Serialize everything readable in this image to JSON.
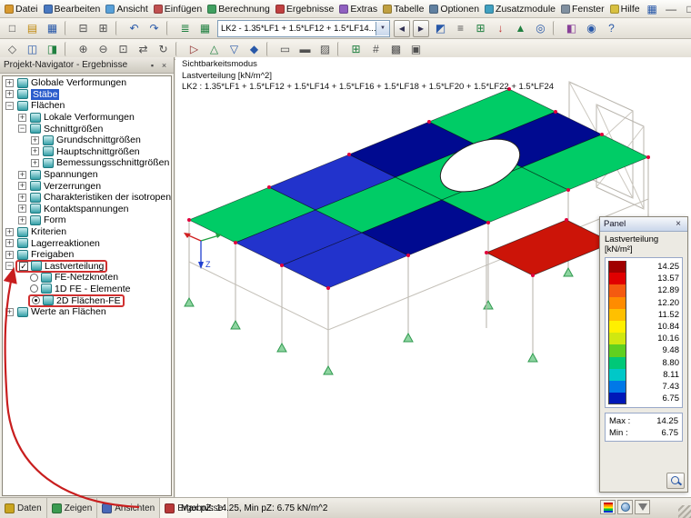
{
  "menu": {
    "items": [
      {
        "label": "Datei",
        "ic": "#d89a30"
      },
      {
        "label": "Bearbeiten",
        "ic": "#4878c0"
      },
      {
        "label": "Ansicht",
        "ic": "#58a0d8"
      },
      {
        "label": "Einfügen",
        "ic": "#c05050"
      },
      {
        "label": "Berechnung",
        "ic": "#40a060"
      },
      {
        "label": "Ergebnisse",
        "ic": "#c04040"
      },
      {
        "label": "Extras",
        "ic": "#9060c0"
      },
      {
        "label": "Tabelle",
        "ic": "#c0a040"
      },
      {
        "label": "Optionen",
        "ic": "#6080a0"
      },
      {
        "label": "Zusatzmodule",
        "ic": "#40a0c0"
      },
      {
        "label": "Fenster",
        "ic": "#8090a0"
      },
      {
        "label": "Hilfe",
        "ic": "#d8c040"
      }
    ],
    "right_icons": [
      {
        "name": "table-view-icon",
        "g": "▦",
        "c": "#2858a8"
      },
      {
        "name": "mdi-minimize-icon",
        "g": "—",
        "c": "#404040"
      },
      {
        "name": "mdi-restore-icon",
        "g": "□",
        "c": "#404040"
      },
      {
        "name": "mdi-close-icon",
        "g": "×",
        "c": "#404040"
      }
    ]
  },
  "toolbar1": {
    "icons_a": [
      {
        "name": "new-project-icon",
        "g": "□",
        "c": "#505050"
      },
      {
        "name": "open-project-icon",
        "g": "▤",
        "c": "#c08a10"
      },
      {
        "name": "save-icon",
        "g": "▦",
        "c": "#2858a8"
      },
      {
        "name": "separator",
        "g": "",
        "cls": "sep"
      },
      {
        "name": "print-icon",
        "g": "⊟",
        "c": "#505050"
      },
      {
        "name": "copy-icon",
        "g": "⊞",
        "c": "#505050"
      },
      {
        "name": "separator",
        "g": "",
        "cls": "sep"
      },
      {
        "name": "undo-icon",
        "g": "↶",
        "c": "#2858a8"
      },
      {
        "name": "redo-icon",
        "g": "↷",
        "c": "#2858a8"
      },
      {
        "name": "separator",
        "g": "",
        "cls": "sep"
      },
      {
        "name": "calculation-icon",
        "g": "≣",
        "c": "#208040"
      },
      {
        "name": "tables-icon",
        "g": "▦",
        "c": "#208040"
      }
    ],
    "combo_value": "LK2 - 1.35*LF1 + 1.5*LF12 + 1.5*LF14...",
    "combo_arrow": "▼",
    "prev_glyph": "◀",
    "next_glyph": "▶",
    "icons_b": [
      {
        "name": "show-results-icon",
        "g": "◩",
        "c": "#2858a8"
      },
      {
        "name": "result-values-icon",
        "g": "≡",
        "c": "#505050"
      },
      {
        "name": "fe-mesh-icon",
        "g": "⊞",
        "c": "#208040"
      },
      {
        "name": "loads-icon",
        "g": "↓",
        "c": "#c03030"
      },
      {
        "name": "supports-icon",
        "g": "▲",
        "c": "#208040"
      },
      {
        "name": "render-icon",
        "g": "◎",
        "c": "#2858a8"
      },
      {
        "name": "separator",
        "g": "",
        "cls": "sep"
      },
      {
        "name": "modules-icon",
        "g": "◧",
        "c": "#884098"
      },
      {
        "name": "info-icon",
        "g": "◉",
        "c": "#2858a8"
      },
      {
        "name": "help-icon",
        "g": "?",
        "c": "#2858a8"
      }
    ]
  },
  "toolbar2": {
    "icons": [
      {
        "name": "pointer-icon",
        "g": "◇",
        "c": "#505050"
      },
      {
        "name": "visibility-mode-icon",
        "g": "◫",
        "c": "#2858a8"
      },
      {
        "name": "visible-objects-icon",
        "g": "◨",
        "c": "#208040"
      },
      {
        "name": "separator",
        "g": "",
        "cls": "sep"
      },
      {
        "name": "zoom-in-icon",
        "g": "⊕",
        "c": "#505050"
      },
      {
        "name": "zoom-out-icon",
        "g": "⊖",
        "c": "#505050"
      },
      {
        "name": "zoom-window-icon",
        "g": "⊡",
        "c": "#505050"
      },
      {
        "name": "pan-icon",
        "g": "⇄",
        "c": "#505050"
      },
      {
        "name": "rotate-view-icon",
        "g": "↻",
        "c": "#505050"
      },
      {
        "name": "separator",
        "g": "",
        "cls": "sep"
      },
      {
        "name": "view-x-icon",
        "g": "▷",
        "c": "#903030"
      },
      {
        "name": "view-y-icon",
        "g": "△",
        "c": "#208040"
      },
      {
        "name": "view-z-icon",
        "g": "▽",
        "c": "#2858a8"
      },
      {
        "name": "isometric-view-icon",
        "g": "◆",
        "c": "#2858a8"
      },
      {
        "name": "separator",
        "g": "",
        "cls": "sep"
      },
      {
        "name": "wireframe-icon",
        "g": "▭",
        "c": "#505050"
      },
      {
        "name": "solid-model-icon",
        "g": "▬",
        "c": "#505050"
      },
      {
        "name": "transparent-icon",
        "g": "▨",
        "c": "#505050"
      },
      {
        "name": "separator",
        "g": "",
        "cls": "sep"
      },
      {
        "name": "mesh-display-icon",
        "g": "⊞",
        "c": "#208040"
      },
      {
        "name": "numbering-icon",
        "g": "#",
        "c": "#505050"
      },
      {
        "name": "background-icon",
        "g": "▩",
        "c": "#505050"
      },
      {
        "name": "margins-icon",
        "g": "▣",
        "c": "#505050"
      }
    ]
  },
  "navigator": {
    "title": "Projekt-Navigator - Ergebnisse",
    "pin_glyph": "▪",
    "close_glyph": "×",
    "tree": [
      {
        "label": "Globale Verformungen",
        "exp": "+",
        "cls": "ind0 has-exp"
      },
      {
        "label": "Stäbe",
        "exp": "+",
        "cls": "ind0 has-exp sel"
      },
      {
        "label": "Flächen",
        "exp": "−",
        "cls": "ind0 has-exp"
      },
      {
        "label": "Lokale Verformungen",
        "exp": "+",
        "cls": "ind1 has-exp"
      },
      {
        "label": "Schnittgrößen",
        "exp": "−",
        "cls": "ind1 has-exp"
      },
      {
        "label": "Grundschnittgrößen",
        "exp": "+",
        "cls": "ind2 has-exp"
      },
      {
        "label": "Hauptschnittgrößen",
        "exp": "+",
        "cls": "ind2 has-exp"
      },
      {
        "label": "Bemessungsschnittgrößen",
        "exp": "+",
        "cls": "ind2 has-exp"
      },
      {
        "label": "Spannungen",
        "exp": "+",
        "cls": "ind1 has-exp"
      },
      {
        "label": "Verzerrungen",
        "exp": "+",
        "cls": "ind1 has-exp"
      },
      {
        "label": "Charakteristiken der isotropen Fläche",
        "exp": "+",
        "cls": "ind1 has-exp"
      },
      {
        "label": "Kontaktspannungen",
        "exp": "+",
        "cls": "ind1 has-exp"
      },
      {
        "label": "Form",
        "exp": "+",
        "cls": "ind1 has-exp"
      },
      {
        "label": "Kriterien",
        "exp": "+",
        "cls": "ind0 has-exp"
      },
      {
        "label": "Lagerreaktionen",
        "exp": "+",
        "cls": "ind0 has-exp"
      },
      {
        "label": "Freigaben",
        "exp": "+",
        "cls": "ind0 has-exp"
      },
      {
        "label": "Lastverteilung",
        "exp": "−",
        "cls": "ind0 has-exp has-chk boxed"
      },
      {
        "label": "FE-Netzknoten",
        "cls": "ind1 has-roff"
      },
      {
        "label": "1D FE - Elemente",
        "cls": "ind1 has-roff"
      },
      {
        "label": "2D Flächen-FE",
        "cls": "ind1 has-ron boxed"
      },
      {
        "label": "Werte an Flächen",
        "exp": "+",
        "cls": "ind0 has-exp"
      }
    ],
    "tabs": [
      {
        "name": "tab-daten",
        "label": "Daten",
        "ic": "#caa520"
      },
      {
        "name": "tab-zeigen",
        "label": "Zeigen",
        "ic": "#3a9a50"
      },
      {
        "name": "tab-ansichten",
        "label": "Ansichten",
        "ic": "#4868b8"
      },
      {
        "name": "tab-ergebnisse",
        "label": "Ergebnisse",
        "ic": "#b83838",
        "cls": "active"
      }
    ]
  },
  "viewport": {
    "info_lines": [
      "Sichtbarkeitsmodus",
      "Lastverteilung [kN/m^2]",
      "LK2 : 1.35*LF1 + 1.5*LF12 + 1.5*LF14 + 1.5*LF16 + 1.5*LF18 + 1.5*LF20 + 1.5*LF22 + 1.5*LF24"
    ],
    "axis_labels": {
      "z": "Z"
    },
    "slab_cells": [
      [
        "green",
        "blue",
        "navy",
        "green"
      ],
      [
        "blue",
        "green",
        "green",
        "navy"
      ],
      [
        "blue",
        "navy",
        "green",
        "green"
      ]
    ],
    "colors": {
      "green": "#00cc66",
      "blue": "#2233cc",
      "navy": "#000a90",
      "red": "#cc1408"
    }
  },
  "panel": {
    "title": "Panel",
    "close_glyph": "×",
    "label_line1": "Lastverteilung",
    "label_line2": "[kN/m²]",
    "scale": [
      {
        "value": "14.25",
        "color": "#a00000"
      },
      {
        "value": "13.57",
        "color": "#e00000"
      },
      {
        "value": "12.89",
        "color": "#f45a10"
      },
      {
        "value": "12.20",
        "color": "#ff8c00"
      },
      {
        "value": "11.52",
        "color": "#ffc000"
      },
      {
        "value": "10.84",
        "color": "#fff000"
      },
      {
        "value": "10.16",
        "color": "#d0e810"
      },
      {
        "value": "9.48",
        "color": "#60d020"
      },
      {
        "value": "8.80",
        "color": "#00c878"
      },
      {
        "value": "8.11",
        "color": "#00c8c8"
      },
      {
        "value": "7.43",
        "color": "#0078e8"
      },
      {
        "value": "6.75",
        "color": "#0018b8"
      }
    ],
    "max_label": "Max :",
    "max_value": "14.25",
    "min_label": "Min :",
    "min_value": "6.75"
  },
  "statusbar": {
    "text": "Max pZ: 14.25, Min pZ: 6.75 kN/m^2"
  }
}
